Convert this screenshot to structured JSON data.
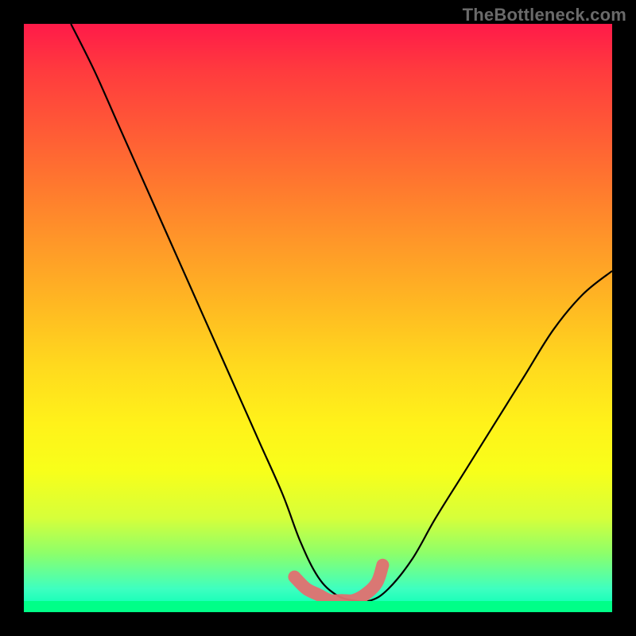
{
  "watermark": "TheBottleneck.com",
  "chart_data": {
    "type": "line",
    "title": "",
    "xlabel": "",
    "ylabel": "",
    "xlim": [
      0,
      100
    ],
    "ylim": [
      0,
      100
    ],
    "grid": false,
    "legend": false,
    "series": [
      {
        "name": "black-curve",
        "color": "#000000",
        "x": [
          8,
          12,
          16,
          20,
          24,
          28,
          32,
          36,
          40,
          44,
          47,
          50,
          53,
          56,
          59,
          62,
          66,
          70,
          75,
          80,
          85,
          90,
          95,
          100
        ],
        "y": [
          100,
          92,
          83,
          74,
          65,
          56,
          47,
          38,
          29,
          20,
          12,
          6,
          3,
          2,
          2,
          4,
          9,
          16,
          24,
          32,
          40,
          48,
          54,
          58
        ]
      },
      {
        "name": "pink-marker",
        "color": "#e17070",
        "x": [
          46,
          48,
          50,
          52,
          54,
          56,
          58,
          60,
          61
        ],
        "y": [
          6,
          4,
          3,
          2,
          2,
          2,
          3,
          5,
          8
        ]
      }
    ],
    "annotations": []
  }
}
